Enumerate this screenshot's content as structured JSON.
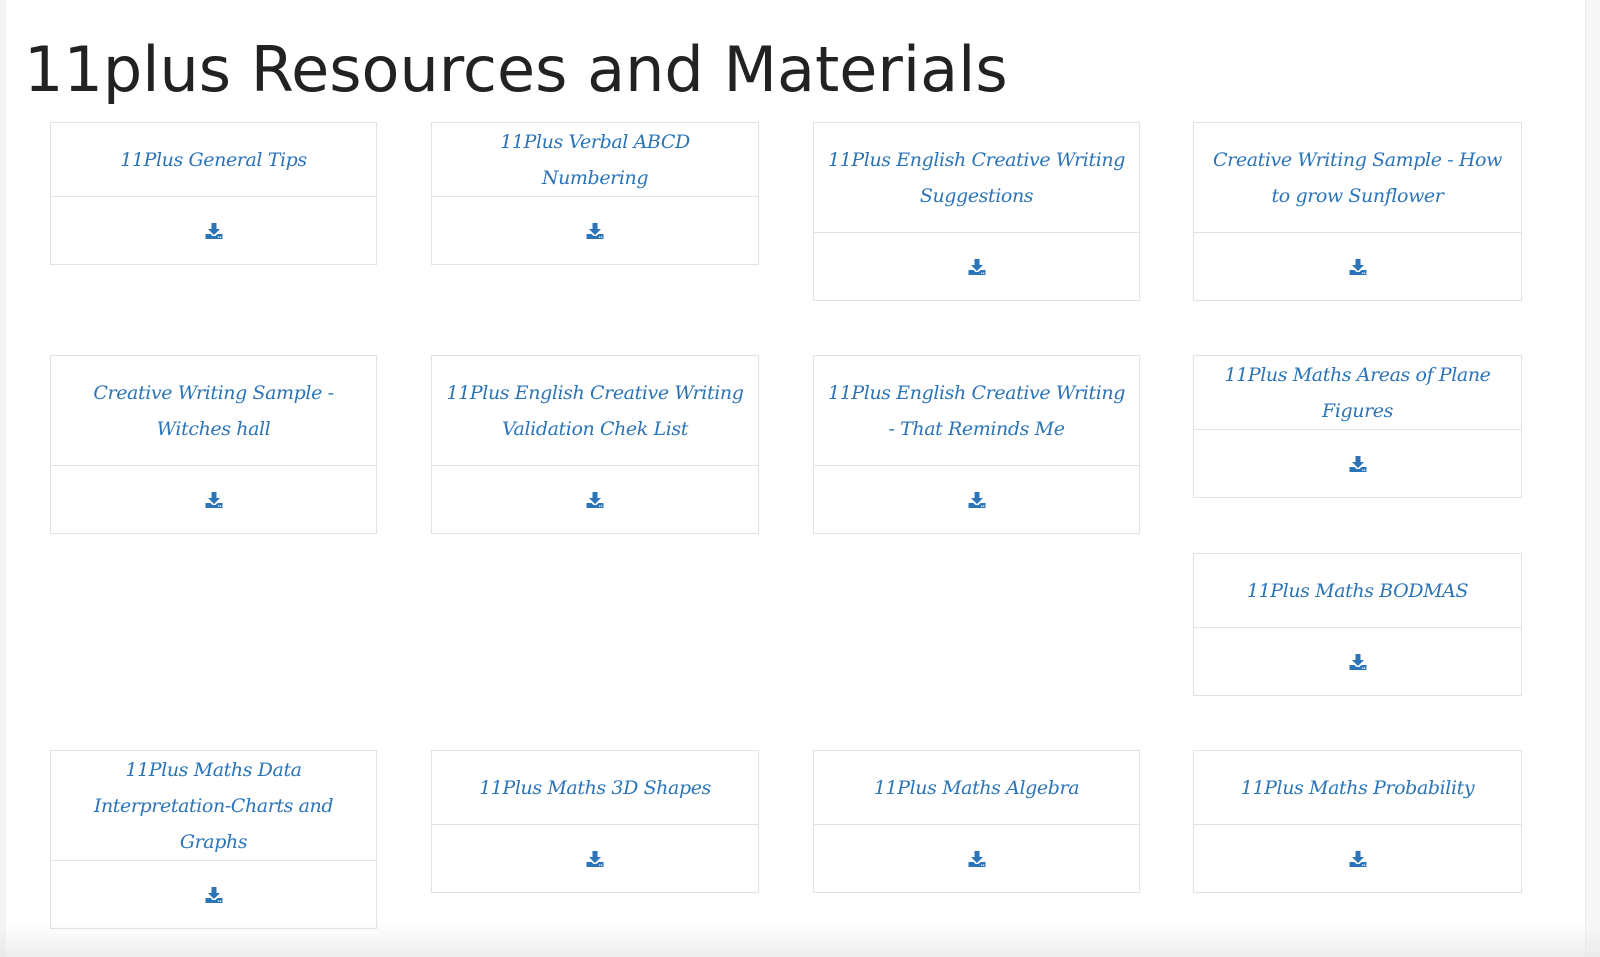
{
  "page": {
    "title": "11plus Resources and Materials"
  },
  "theme": {
    "accent": "#2b74b8",
    "border": "#e3e3e3",
    "title_color": "#222222"
  },
  "resources": [
    {
      "title": "11Plus General Tips",
      "action_icon": "download-icon"
    },
    {
      "title": "11Plus Verbal ABCD Numbering",
      "action_icon": "download-icon"
    },
    {
      "title": "11Plus English Creative Writing Suggestions",
      "action_icon": "download-icon"
    },
    {
      "title": "Creative Writing Sample - How to grow Sunflower",
      "action_icon": "download-icon"
    },
    {
      "title": "Creative Writing Sample - Witches hall",
      "action_icon": "download-icon"
    },
    {
      "title": "11Plus English Creative Writing Validation Chek List",
      "action_icon": "download-icon"
    },
    {
      "title": "11Plus English Creative Writing - That Reminds Me",
      "action_icon": "download-icon"
    },
    {
      "title": "11Plus Maths Areas of Plane Figures",
      "action_icon": "download-icon"
    },
    {
      "title": "11Plus Maths BODMAS",
      "action_icon": "download-icon"
    },
    {
      "title": "11Plus Maths Data Interpretation-Charts and Graphs",
      "action_icon": "download-icon"
    },
    {
      "title": "11Plus Maths 3D Shapes",
      "action_icon": "download-icon"
    },
    {
      "title": "11Plus Maths Algebra",
      "action_icon": "download-icon"
    },
    {
      "title": "11Plus Maths Probability",
      "action_icon": "download-icon"
    }
  ]
}
